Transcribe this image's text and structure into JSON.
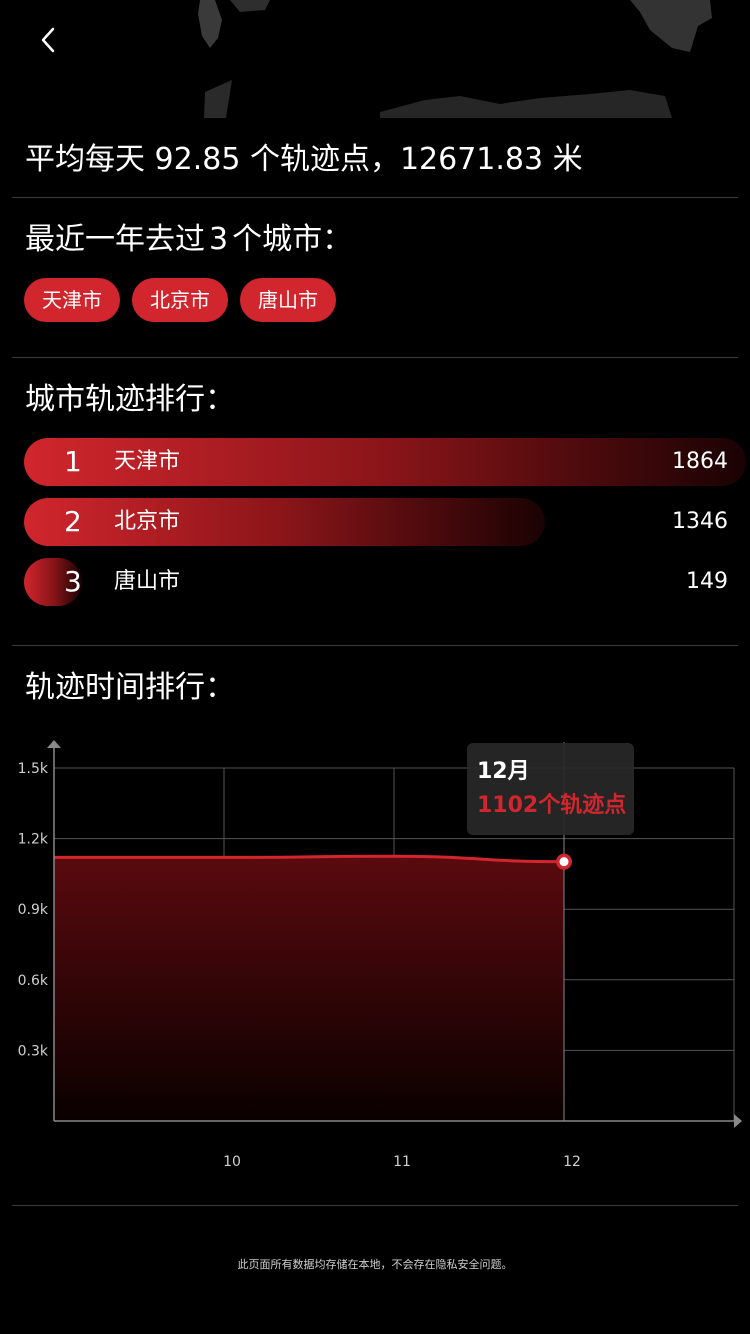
{
  "header": {
    "back_icon": "chevron-left-icon",
    "map_icon": "world-map-silhouette"
  },
  "summary": {
    "avg_text": "平均每天 92.85 个轨迹点，12671.83 米"
  },
  "cities": {
    "title_prefix": "最近一年去过",
    "count": "3",
    "title_suffix": "个城市：",
    "chips": [
      "天津市",
      "北京市",
      "唐山市"
    ]
  },
  "ranking": {
    "title": "城市轨迹排行：",
    "rows": [
      {
        "rank": "1",
        "city": "天津市",
        "count": 1864
      },
      {
        "rank": "2",
        "city": "北京市",
        "count": 1346
      },
      {
        "rank": "3",
        "city": "唐山市",
        "count": 149
      }
    ]
  },
  "time_ranking": {
    "title": "轨迹时间排行："
  },
  "tooltip": {
    "month": "12月",
    "value": "1102个轨迹点"
  },
  "chart_data": {
    "type": "area",
    "x": [
      9,
      10,
      11,
      12
    ],
    "x_tick_labels": [
      "10",
      "11",
      "12"
    ],
    "x_tick_values": [
      10,
      11,
      12
    ],
    "y_tick_labels": [
      "0.3k",
      "0.6k",
      "0.9k",
      "1.2k",
      "1.5k"
    ],
    "y_tick_values": [
      300,
      600,
      900,
      1200,
      1500
    ],
    "ylim": [
      0,
      1500
    ],
    "xlim": [
      9,
      13
    ],
    "series": [
      {
        "values": [
          1120,
          1120,
          1125,
          1102
        ]
      }
    ],
    "highlight": {
      "x": 12,
      "y": 1102
    },
    "grid": true,
    "colors": {
      "line": "#d1262d",
      "fill_top": "#5a0a0e",
      "fill_bottom": "#0a0000"
    }
  },
  "colors": {
    "accent": "#d1262d",
    "divider": "#3a3a3a"
  },
  "footer": {
    "note": "此页面所有数据均存储在本地，不会存在隐私安全问题。"
  }
}
